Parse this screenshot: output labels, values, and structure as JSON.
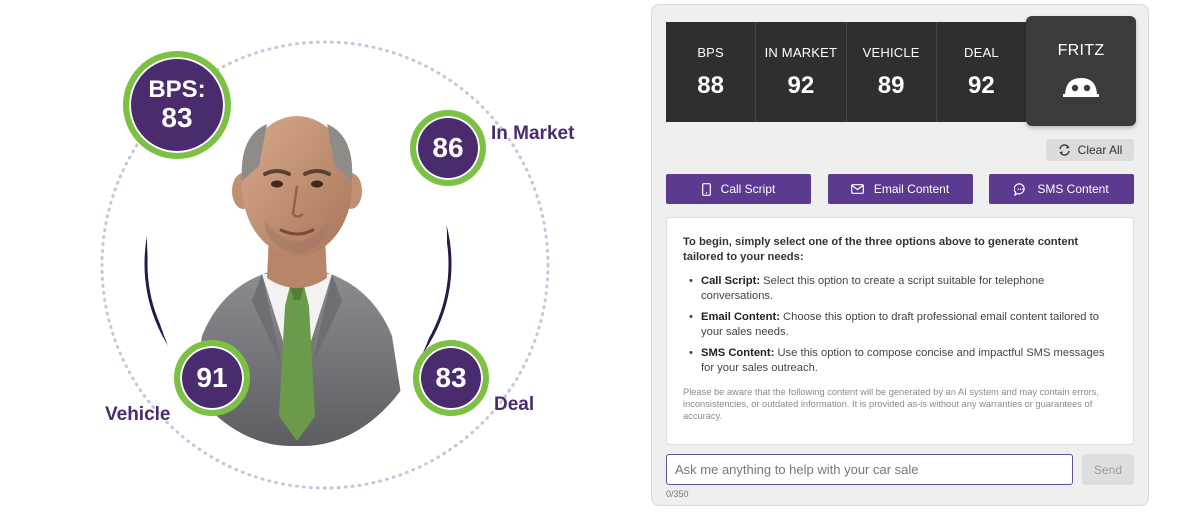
{
  "illustration": {
    "bps_label": "BPS:",
    "bps_value": "83",
    "in_market_value": "86",
    "in_market_label": "In Market",
    "vehicle_value": "91",
    "vehicle_label": "Vehicle",
    "deal_value": "83",
    "deal_label": "Deal",
    "colors": {
      "bubble": "#4a2b6e",
      "ring": "#7cc242"
    }
  },
  "panel": {
    "scores": [
      {
        "name": "BPS",
        "value": "88"
      },
      {
        "name": "IN MARKET",
        "value": "92"
      },
      {
        "name": "VEHICLE",
        "value": "89"
      },
      {
        "name": "DEAL",
        "value": "92"
      }
    ],
    "assistant": {
      "name": "FRITZ",
      "icon": "robot-icon"
    },
    "clear_label": "Clear All",
    "actions": [
      {
        "label": "Call Script",
        "icon": "phone-icon"
      },
      {
        "label": "Email Content",
        "icon": "email-icon"
      },
      {
        "label": "SMS Content",
        "icon": "chat-icon"
      }
    ],
    "content": {
      "intro": "To begin, simply select one of the three options above to generate content tailored to your needs:",
      "options": [
        {
          "title": "Call Script:",
          "text": "Select this option to create a script suitable for telephone conversations."
        },
        {
          "title": "Email Content:",
          "text": "Choose this option to draft professional email content tailored to your sales needs."
        },
        {
          "title": "SMS Content:",
          "text": "Use this option to compose concise and impactful SMS messages for your sales outreach."
        }
      ],
      "disclaimer": "Please be aware that the following content will be generated by an AI system and may contain errors, inconsistencies, or outdated information. It is provided as-is without any warranties or guarantees of accuracy."
    },
    "input": {
      "placeholder": "Ask me anything to help with your car sale",
      "value": ""
    },
    "send_label": "Send",
    "char_counter": "0/350",
    "colors": {
      "action": "#5b3a8f",
      "scores_bg": "#2f2f2f",
      "fritz_bg": "#3b3b3b"
    }
  }
}
